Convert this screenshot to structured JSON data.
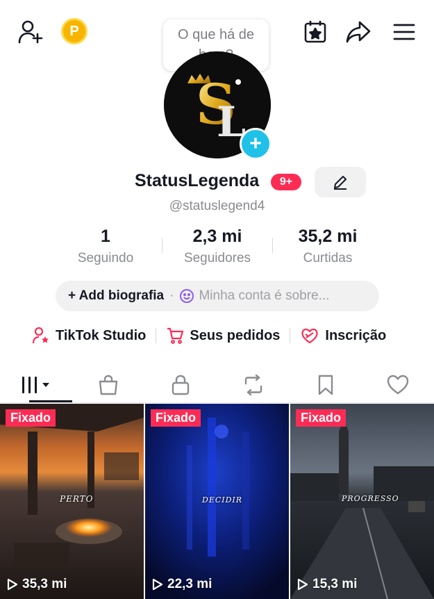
{
  "top": {
    "coin_letter": "P"
  },
  "bubble": {
    "line1": "O que há de",
    "line2": "bom?"
  },
  "profile": {
    "username": "StatusLegenda",
    "notif_count": "9+",
    "handle": "@statuslegend4"
  },
  "stats": [
    {
      "value": "1",
      "label": "Seguindo"
    },
    {
      "value": "2,3 mi",
      "label": "Seguidores"
    },
    {
      "value": "35,2 mi",
      "label": "Curtidas"
    }
  ],
  "bio": {
    "add_label": "+ Add biografia",
    "separator": "·",
    "placeholder": "Minha conta é sobre..."
  },
  "links": [
    {
      "label": "TikTok Studio",
      "icon": "person-star-icon"
    },
    {
      "label": "Seus pedidos",
      "icon": "cart-icon"
    },
    {
      "label": "Inscrição",
      "icon": "heart-ribbon-icon"
    }
  ],
  "tabs": [
    "videos-grid-icon",
    "shop-bag-icon",
    "lock-icon",
    "repost-icon",
    "bookmark-icon",
    "heart-icon"
  ],
  "videos": [
    {
      "pinned": "Fixado",
      "views": "35,3 mi",
      "caption": "PERTO"
    },
    {
      "pinned": "Fixado",
      "views": "22,3 mi",
      "caption": "DECIDIR"
    },
    {
      "pinned": "Fixado",
      "views": "15,3 mi",
      "caption": "PROGRESSO"
    }
  ],
  "colors": {
    "accent": "#fe2c55",
    "text": "#161823",
    "muted": "#8a8b91",
    "cyan": "#20c1e8"
  }
}
